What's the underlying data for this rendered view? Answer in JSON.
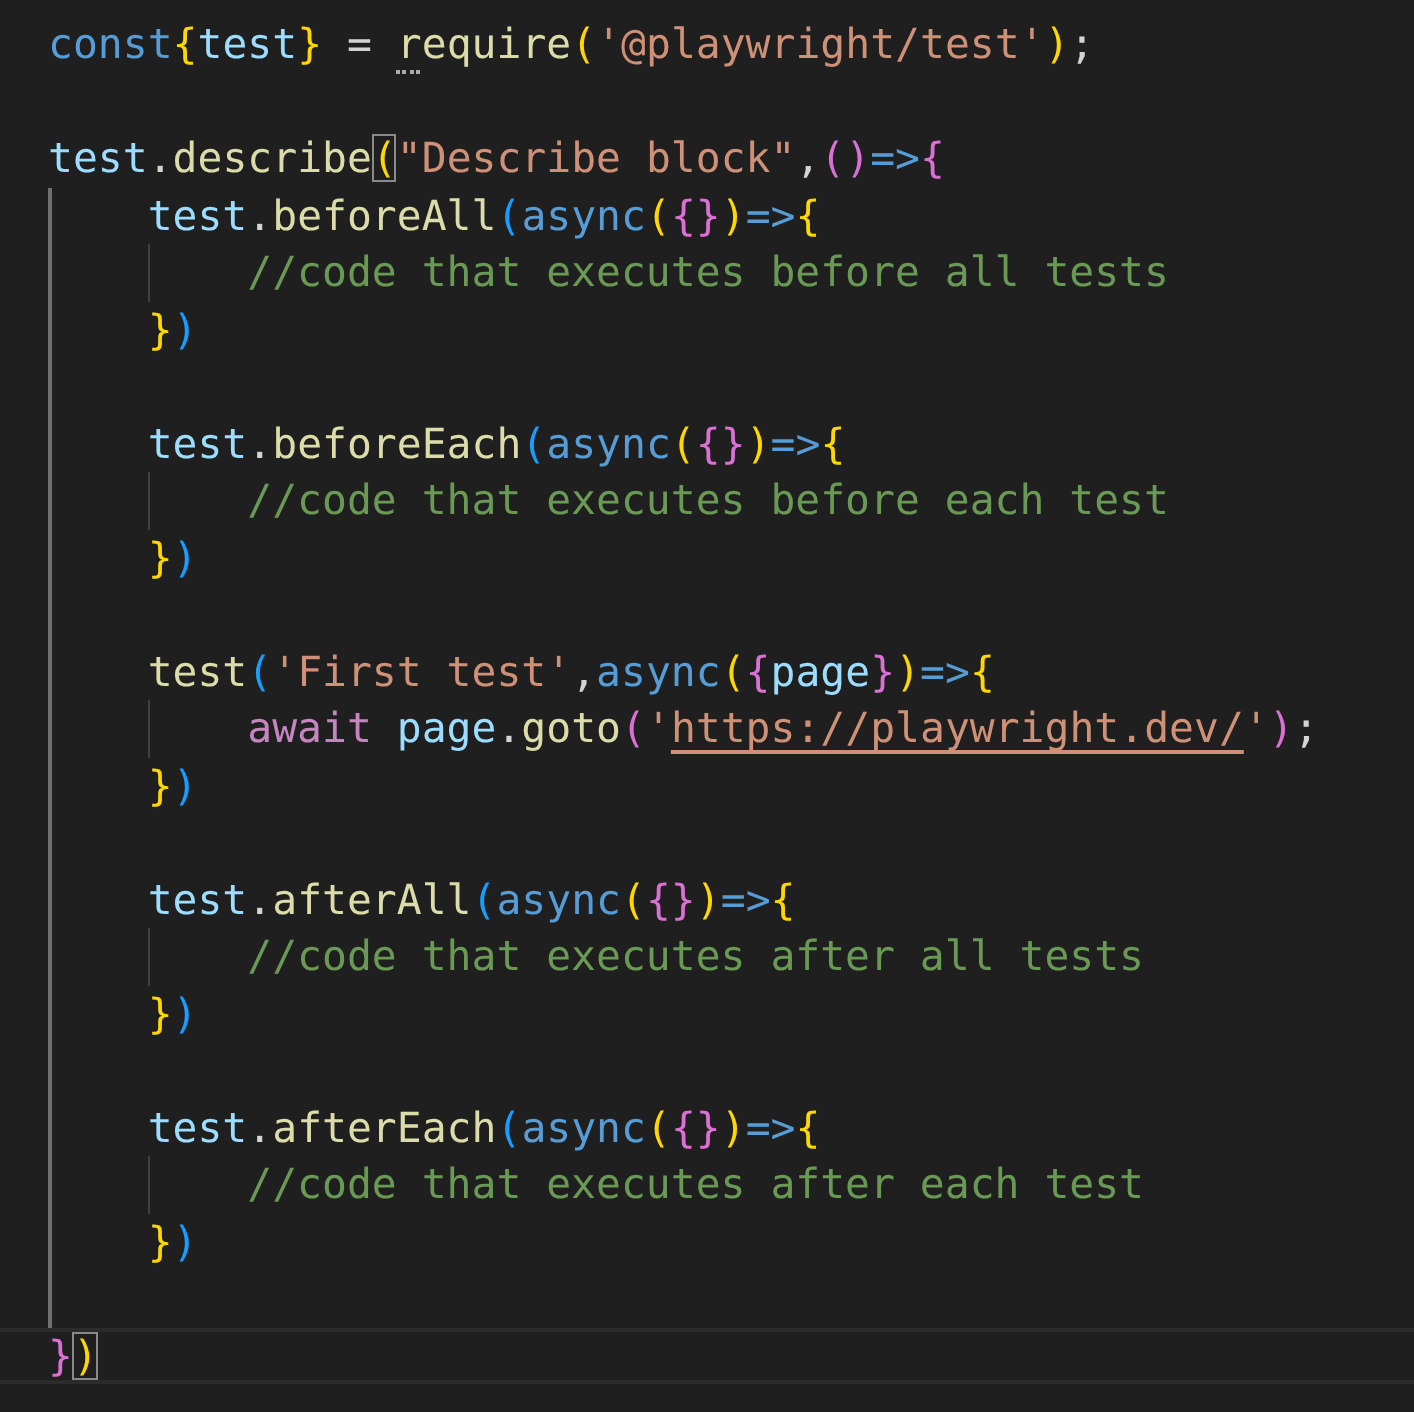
{
  "editor": {
    "lines": [
      {
        "kind": "code",
        "tokens": [
          {
            "text": "const",
            "kind": "keyword"
          },
          {
            "text": "{",
            "kind": "bracket1"
          },
          {
            "text": "test",
            "kind": "variable"
          },
          {
            "text": "}",
            "kind": "bracket1"
          },
          {
            "text": " = ",
            "kind": "plain"
          },
          {
            "text": "require",
            "kind": "function",
            "hint": true
          },
          {
            "text": "(",
            "kind": "bracket1"
          },
          {
            "text": "'@playwright/test'",
            "kind": "string"
          },
          {
            "text": ")",
            "kind": "bracket1"
          },
          {
            "text": ";",
            "kind": "plain"
          }
        ]
      },
      {
        "kind": "blank"
      },
      {
        "kind": "code",
        "tokens": [
          {
            "text": "test",
            "kind": "variable"
          },
          {
            "text": ".",
            "kind": "plain"
          },
          {
            "text": "describe",
            "kind": "function"
          },
          {
            "text": "(",
            "kind": "bracket1",
            "matched": true
          },
          {
            "text": "\"Describe block\"",
            "kind": "string"
          },
          {
            "text": ",",
            "kind": "plain"
          },
          {
            "text": "()",
            "kind": "bracket2"
          },
          {
            "text": "=>",
            "kind": "keyword"
          },
          {
            "text": "{",
            "kind": "bracket2"
          }
        ]
      },
      {
        "kind": "code",
        "tokens": [
          {
            "text": "    test",
            "kind": "variable"
          },
          {
            "text": ".",
            "kind": "plain"
          },
          {
            "text": "beforeAll",
            "kind": "function"
          },
          {
            "text": "(",
            "kind": "bracket3"
          },
          {
            "text": "async",
            "kind": "keyword"
          },
          {
            "text": "(",
            "kind": "bracket1"
          },
          {
            "text": "{}",
            "kind": "bracket2"
          },
          {
            "text": ")",
            "kind": "bracket1"
          },
          {
            "text": "=>",
            "kind": "keyword"
          },
          {
            "text": "{",
            "kind": "bracket1"
          }
        ]
      },
      {
        "kind": "code",
        "tokens": [
          {
            "text": "        //code that executes before all tests",
            "kind": "comment"
          }
        ]
      },
      {
        "kind": "code",
        "tokens": [
          {
            "text": "    }",
            "kind": "bracket1"
          },
          {
            "text": ")",
            "kind": "bracket3"
          }
        ]
      },
      {
        "kind": "blank"
      },
      {
        "kind": "code",
        "tokens": [
          {
            "text": "    test",
            "kind": "variable"
          },
          {
            "text": ".",
            "kind": "plain"
          },
          {
            "text": "beforeEach",
            "kind": "function"
          },
          {
            "text": "(",
            "kind": "bracket3"
          },
          {
            "text": "async",
            "kind": "keyword"
          },
          {
            "text": "(",
            "kind": "bracket1"
          },
          {
            "text": "{}",
            "kind": "bracket2"
          },
          {
            "text": ")",
            "kind": "bracket1"
          },
          {
            "text": "=>",
            "kind": "keyword"
          },
          {
            "text": "{",
            "kind": "bracket1"
          }
        ]
      },
      {
        "kind": "code",
        "tokens": [
          {
            "text": "        //code that executes before each test",
            "kind": "comment"
          }
        ]
      },
      {
        "kind": "code",
        "tokens": [
          {
            "text": "    }",
            "kind": "bracket1"
          },
          {
            "text": ")",
            "kind": "bracket3"
          }
        ]
      },
      {
        "kind": "blank"
      },
      {
        "kind": "code",
        "tokens": [
          {
            "text": "    test",
            "kind": "function"
          },
          {
            "text": "(",
            "kind": "bracket3"
          },
          {
            "text": "'First test'",
            "kind": "string"
          },
          {
            "text": ",",
            "kind": "plain"
          },
          {
            "text": "async",
            "kind": "keyword"
          },
          {
            "text": "(",
            "kind": "bracket1"
          },
          {
            "text": "{",
            "kind": "bracket2"
          },
          {
            "text": "page",
            "kind": "variable"
          },
          {
            "text": "}",
            "kind": "bracket2"
          },
          {
            "text": ")",
            "kind": "bracket1"
          },
          {
            "text": "=>",
            "kind": "keyword"
          },
          {
            "text": "{",
            "kind": "bracket1"
          }
        ]
      },
      {
        "kind": "code",
        "tokens": [
          {
            "text": "        await",
            "kind": "control"
          },
          {
            "text": " page",
            "kind": "variable"
          },
          {
            "text": ".",
            "kind": "plain"
          },
          {
            "text": "goto",
            "kind": "function"
          },
          {
            "text": "(",
            "kind": "bracket2"
          },
          {
            "text": "'",
            "kind": "string"
          },
          {
            "text": "https://playwright.dev/",
            "kind": "string",
            "link": true
          },
          {
            "text": "'",
            "kind": "string"
          },
          {
            "text": ")",
            "kind": "bracket2"
          },
          {
            "text": ";",
            "kind": "plain"
          }
        ]
      },
      {
        "kind": "code",
        "tokens": [
          {
            "text": "    }",
            "kind": "bracket1"
          },
          {
            "text": ")",
            "kind": "bracket3"
          }
        ]
      },
      {
        "kind": "blank"
      },
      {
        "kind": "code",
        "tokens": [
          {
            "text": "    test",
            "kind": "variable"
          },
          {
            "text": ".",
            "kind": "plain"
          },
          {
            "text": "afterAll",
            "kind": "function"
          },
          {
            "text": "(",
            "kind": "bracket3"
          },
          {
            "text": "async",
            "kind": "keyword"
          },
          {
            "text": "(",
            "kind": "bracket1"
          },
          {
            "text": "{}",
            "kind": "bracket2"
          },
          {
            "text": ")",
            "kind": "bracket1"
          },
          {
            "text": "=>",
            "kind": "keyword"
          },
          {
            "text": "{",
            "kind": "bracket1"
          }
        ]
      },
      {
        "kind": "code",
        "tokens": [
          {
            "text": "        //code that executes after all tests",
            "kind": "comment"
          }
        ]
      },
      {
        "kind": "code",
        "tokens": [
          {
            "text": "    }",
            "kind": "bracket1"
          },
          {
            "text": ")",
            "kind": "bracket3"
          }
        ]
      },
      {
        "kind": "blank"
      },
      {
        "kind": "code",
        "tokens": [
          {
            "text": "    test",
            "kind": "variable"
          },
          {
            "text": ".",
            "kind": "plain"
          },
          {
            "text": "afterEach",
            "kind": "function"
          },
          {
            "text": "(",
            "kind": "bracket3"
          },
          {
            "text": "async",
            "kind": "keyword"
          },
          {
            "text": "(",
            "kind": "bracket1"
          },
          {
            "text": "{}",
            "kind": "bracket2"
          },
          {
            "text": ")",
            "kind": "bracket1"
          },
          {
            "text": "=>",
            "kind": "keyword"
          },
          {
            "text": "{",
            "kind": "bracket1"
          }
        ]
      },
      {
        "kind": "code",
        "tokens": [
          {
            "text": "        //code that executes after each test",
            "kind": "comment"
          }
        ]
      },
      {
        "kind": "code",
        "tokens": [
          {
            "text": "    }",
            "kind": "bracket1"
          },
          {
            "text": ")",
            "kind": "bracket3"
          }
        ]
      },
      {
        "kind": "blank"
      },
      {
        "kind": "code",
        "tokens": [
          {
            "text": "}",
            "kind": "bracket2"
          },
          {
            "text": ")",
            "kind": "bracket1",
            "matched": true
          }
        ],
        "current": true
      }
    ]
  }
}
